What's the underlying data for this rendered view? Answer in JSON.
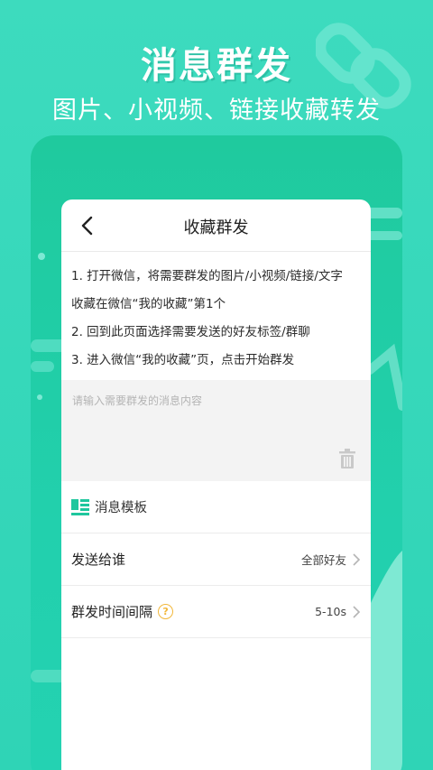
{
  "hero": {
    "title": "消息群发",
    "subtitle": "图片、小视频、链接收藏转发"
  },
  "nav": {
    "title": "收藏群发"
  },
  "instructions": [
    "1. 打开微信，将需要群发的图片/小视频/链接/文字",
    "收藏在微信“我的收藏”第1个",
    "2. 回到此页面选择需要发送的好友标签/群聊",
    "3. 进入微信“我的收藏”页，点击开始群发"
  ],
  "message_input": {
    "placeholder": "请输入需要群发的消息内容",
    "value": ""
  },
  "template": {
    "label": "消息模板"
  },
  "recipients_row": {
    "label": "发送给谁",
    "value": "全部好友"
  },
  "interval_row": {
    "label": "群发时间间隔",
    "value": "5-10s"
  },
  "colors": {
    "background": "#34d8bb",
    "accent": "#1fc79e",
    "help_icon": "#f2b73a"
  },
  "icons": [
    "chain-link-icon",
    "back-arrow-icon",
    "trash-icon",
    "template-icon",
    "question-icon",
    "chevron-right-icon"
  ]
}
